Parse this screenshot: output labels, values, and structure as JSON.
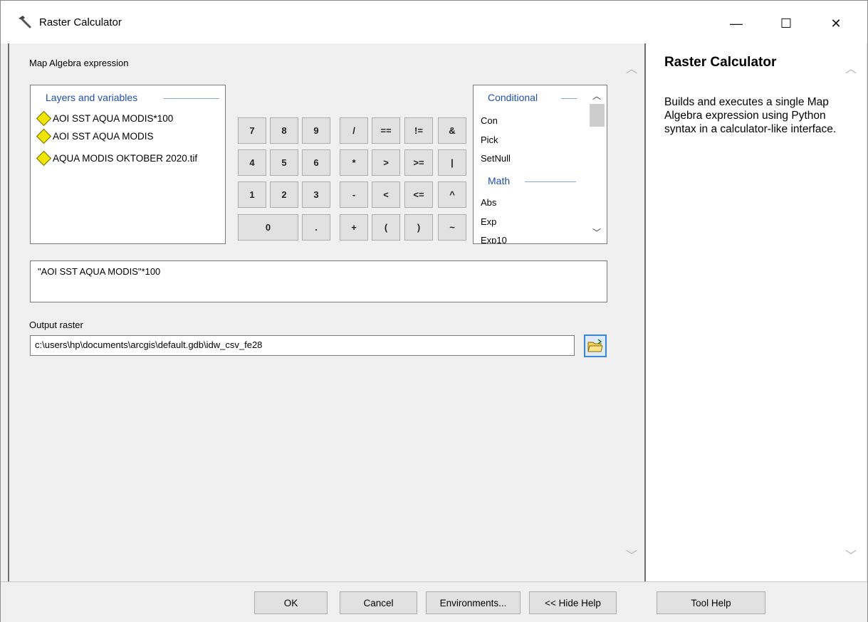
{
  "window": {
    "title": "Raster Calculator",
    "controls": {
      "minimize": "—",
      "maximize": "☐",
      "close": "✕"
    }
  },
  "form": {
    "expression_label": "Map Algebra expression",
    "layers": {
      "heading": "Layers and variables",
      "items": [
        "AOI SST AQUA MODIS*100",
        "AOI SST AQUA MODIS",
        "AQUA MODIS OKTOBER 2020.tif"
      ]
    },
    "keypad": {
      "row1": [
        "7",
        "8",
        "9",
        "/",
        "==",
        "!=",
        "&"
      ],
      "row2": [
        "4",
        "5",
        "6",
        "*",
        ">",
        ">=",
        "|"
      ],
      "row3": [
        "1",
        "2",
        "3",
        "-",
        "<",
        "<=",
        "^"
      ],
      "row4": [
        "0",
        ".",
        "+",
        "(",
        ")",
        "~"
      ]
    },
    "functions": {
      "conditional_heading": "Conditional",
      "conditional": [
        "Con",
        "Pick",
        "SetNull"
      ],
      "math_heading": "Math",
      "math": [
        "Abs",
        "Exp",
        "Exp10"
      ]
    },
    "expression_value": "\"AOI SST AQUA MODIS\"*100",
    "output_label": "Output raster",
    "output_value": "c:\\users\\hp\\documents\\arcgis\\default.gdb\\idw_csv_fe28"
  },
  "help": {
    "title": "Raster Calculator",
    "body": "Builds and executes a single Map Algebra expression using Python syntax in a calculator-like interface."
  },
  "buttons": {
    "ok": "OK",
    "cancel": "Cancel",
    "environments": "Environments...",
    "hide_help": "<< Hide Help",
    "tool_help": "Tool Help"
  },
  "colors": {
    "section_heading": "#1f4fa5",
    "diamond": "#f2e600",
    "browse_border": "#3a85d6"
  }
}
